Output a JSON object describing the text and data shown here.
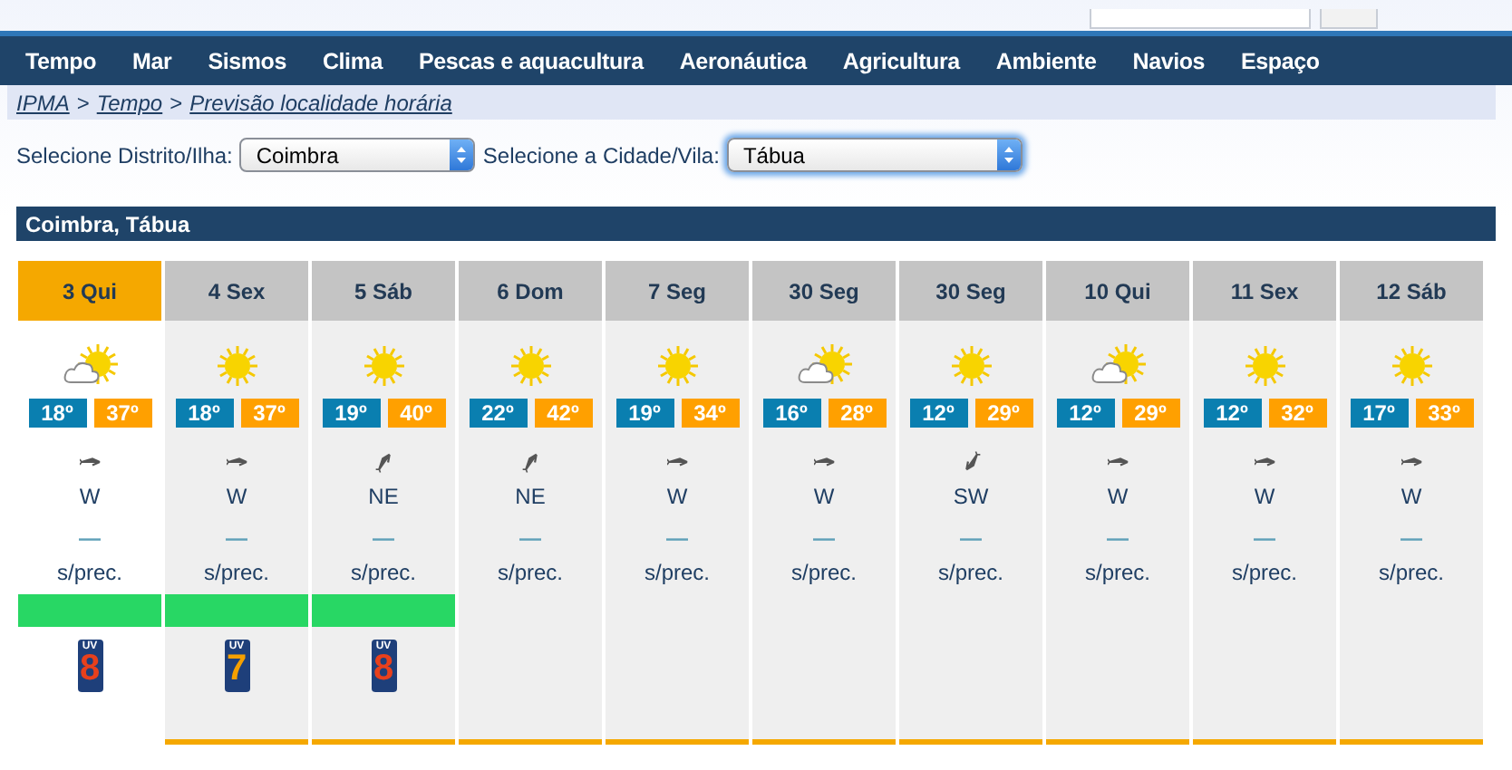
{
  "nav": [
    {
      "label": "Tempo",
      "selected": false
    },
    {
      "label": "Mar",
      "selected": false
    },
    {
      "label": "Sismos",
      "selected": false
    },
    {
      "label": "Clima",
      "selected": false
    },
    {
      "label": "Pescas e aquacultura",
      "selected": false
    },
    {
      "label": "Aeronáutica",
      "selected": false
    },
    {
      "label": "Agricultura",
      "selected": false
    },
    {
      "label": "Ambiente",
      "selected": false
    },
    {
      "label": "Navios",
      "selected": false
    },
    {
      "label": "Espaço",
      "selected": false
    }
  ],
  "breadcrumb": [
    {
      "label": "IPMA"
    },
    {
      "separator": ">",
      "label": "Tempo"
    },
    {
      "separator": ">",
      "label": "Previsão localidade horária"
    }
  ],
  "filters": [
    {
      "label": "Selecione Distrito/Ilha:",
      "value": "Coimbra",
      "focused": false
    },
    {
      "label": "Selecione a Cidade/Vila:",
      "value": "Tábua",
      "focused": true
    }
  ],
  "section_title": "Coimbra, Tábua",
  "days": [
    {
      "label": "3 Qui",
      "selected": true,
      "weather": {
        "kind": "partly"
      },
      "min": "18º",
      "max": "37º",
      "wind_arrow": {
        "kind": "right"
      },
      "wind": "W",
      "rain_mark": "—",
      "rain": "s/prec.",
      "risk": {
        "color": "#28d764"
      },
      "uv": {
        "label": "UV",
        "value": "8",
        "color": "#e8401c"
      }
    },
    {
      "label": "4 Sex",
      "selected": false,
      "weather": {
        "kind": "sun"
      },
      "min": "18º",
      "max": "37º",
      "wind_arrow": {
        "kind": "right"
      },
      "wind": "W",
      "rain_mark": "—",
      "rain": "s/prec.",
      "risk": {
        "color": "#28d764"
      },
      "uv": {
        "label": "UV",
        "value": "7",
        "color": "#f5a000"
      }
    },
    {
      "label": "5 Sáb",
      "selected": false,
      "weather": {
        "kind": "sun"
      },
      "min": "19º",
      "max": "40º",
      "wind_arrow": {
        "kind": "up-right"
      },
      "wind": "NE",
      "rain_mark": "—",
      "rain": "s/prec.",
      "risk": {
        "color": "#28d764"
      },
      "uv": {
        "label": "UV",
        "value": "8",
        "color": "#e8401c"
      }
    },
    {
      "label": "6 Dom",
      "selected": false,
      "weather": {
        "kind": "sun"
      },
      "min": "22º",
      "max": "42º",
      "wind_arrow": {
        "kind": "up-right"
      },
      "wind": "NE",
      "rain_mark": "—",
      "rain": "s/prec."
    },
    {
      "label": "7 Seg",
      "selected": false,
      "weather": {
        "kind": "sun"
      },
      "min": "19º",
      "max": "34º",
      "wind_arrow": {
        "kind": "right"
      },
      "wind": "W",
      "rain_mark": "—",
      "rain": "s/prec."
    },
    {
      "label": "30 Seg",
      "selected": false,
      "weather": {
        "kind": "partly"
      },
      "min": "16º",
      "max": "28º",
      "wind_arrow": {
        "kind": "right"
      },
      "wind": "W",
      "rain_mark": "—",
      "rain": "s/prec."
    },
    {
      "label": "30 Seg",
      "selected": false,
      "weather": {
        "kind": "sun"
      },
      "min": "12º",
      "max": "29º",
      "wind_arrow": {
        "kind": "down-left"
      },
      "wind": "SW",
      "rain_mark": "—",
      "rain": "s/prec."
    },
    {
      "label": "10 Qui",
      "selected": false,
      "weather": {
        "kind": "partly"
      },
      "min": "12º",
      "max": "29º",
      "wind_arrow": {
        "kind": "right"
      },
      "wind": "W",
      "rain_mark": "—",
      "rain": "s/prec."
    },
    {
      "label": "11 Sex",
      "selected": false,
      "weather": {
        "kind": "sun"
      },
      "min": "12º",
      "max": "32º",
      "wind_arrow": {
        "kind": "right"
      },
      "wind": "W",
      "rain_mark": "—",
      "rain": "s/prec."
    },
    {
      "label": "12 Sáb",
      "selected": false,
      "weather": {
        "kind": "sun"
      },
      "min": "17º",
      "max": "33º",
      "wind_arrow": {
        "kind": "right"
      },
      "wind": "W",
      "rain_mark": "—",
      "rain": "s/prec."
    }
  ]
}
